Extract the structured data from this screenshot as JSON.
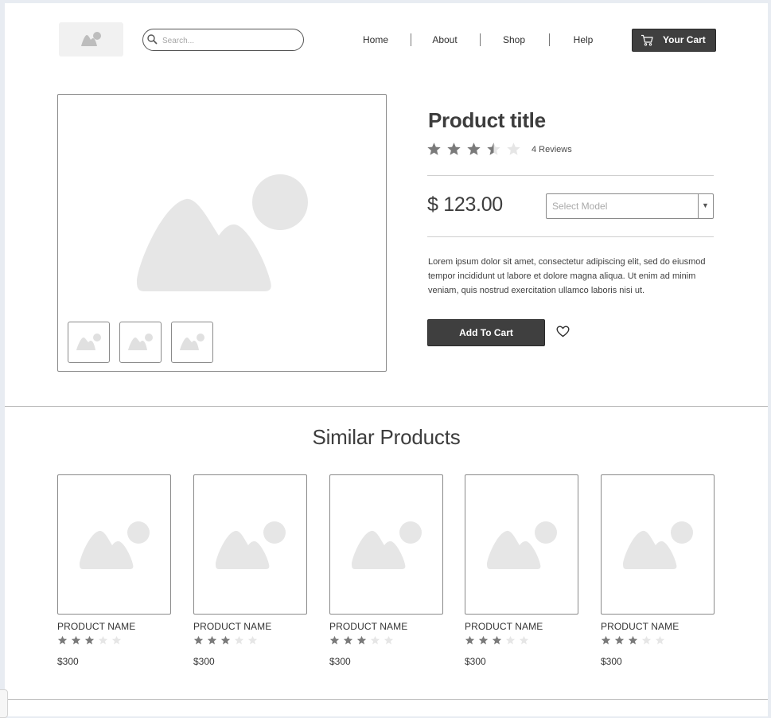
{
  "header": {
    "logo_icon": "image-placeholder-icon",
    "search": {
      "placeholder": "Search...",
      "value": "",
      "icon": "search-icon"
    },
    "nav": [
      "Home",
      "About",
      "Shop",
      "Help"
    ],
    "cart_button": {
      "label": "Your Cart",
      "icon": "cart-icon"
    }
  },
  "product": {
    "title": "Product title",
    "rating": 3.5,
    "max_rating": 5,
    "reviews_label": "4 Reviews",
    "price": "$ 123.00",
    "model_select": {
      "placeholder": "Select Model",
      "arrow": "▼"
    },
    "description": "Lorem ipsum dolor sit amet, consectetur adipiscing elit, sed do eiusmod tempor incididunt ut labore et dolore magna aliqua. Ut enim ad minim veniam, quis nostrud exercitation ullamco laboris nisi ut.",
    "add_to_cart_label": "Add To Cart",
    "wishlist_icon": "heart-icon",
    "thumbnail_count": 3
  },
  "similar": {
    "title": "Similar Products",
    "items": [
      {
        "name": "PRODUCT NAME",
        "price": "$300",
        "rating": 3,
        "max_rating": 5
      },
      {
        "name": "PRODUCT NAME",
        "price": "$300",
        "rating": 3,
        "max_rating": 5
      },
      {
        "name": "PRODUCT NAME",
        "price": "$300",
        "rating": 3,
        "max_rating": 5
      },
      {
        "name": "PRODUCT NAME",
        "price": "$300",
        "rating": 3,
        "max_rating": 5
      },
      {
        "name": "PRODUCT NAME",
        "price": "$300",
        "rating": 3,
        "max_rating": 5
      }
    ]
  },
  "colors": {
    "dark": "#3f3f3f",
    "star_filled": "#7a7a7a",
    "star_empty": "#e6e6e6",
    "placeholder": "#e6e6e6"
  }
}
